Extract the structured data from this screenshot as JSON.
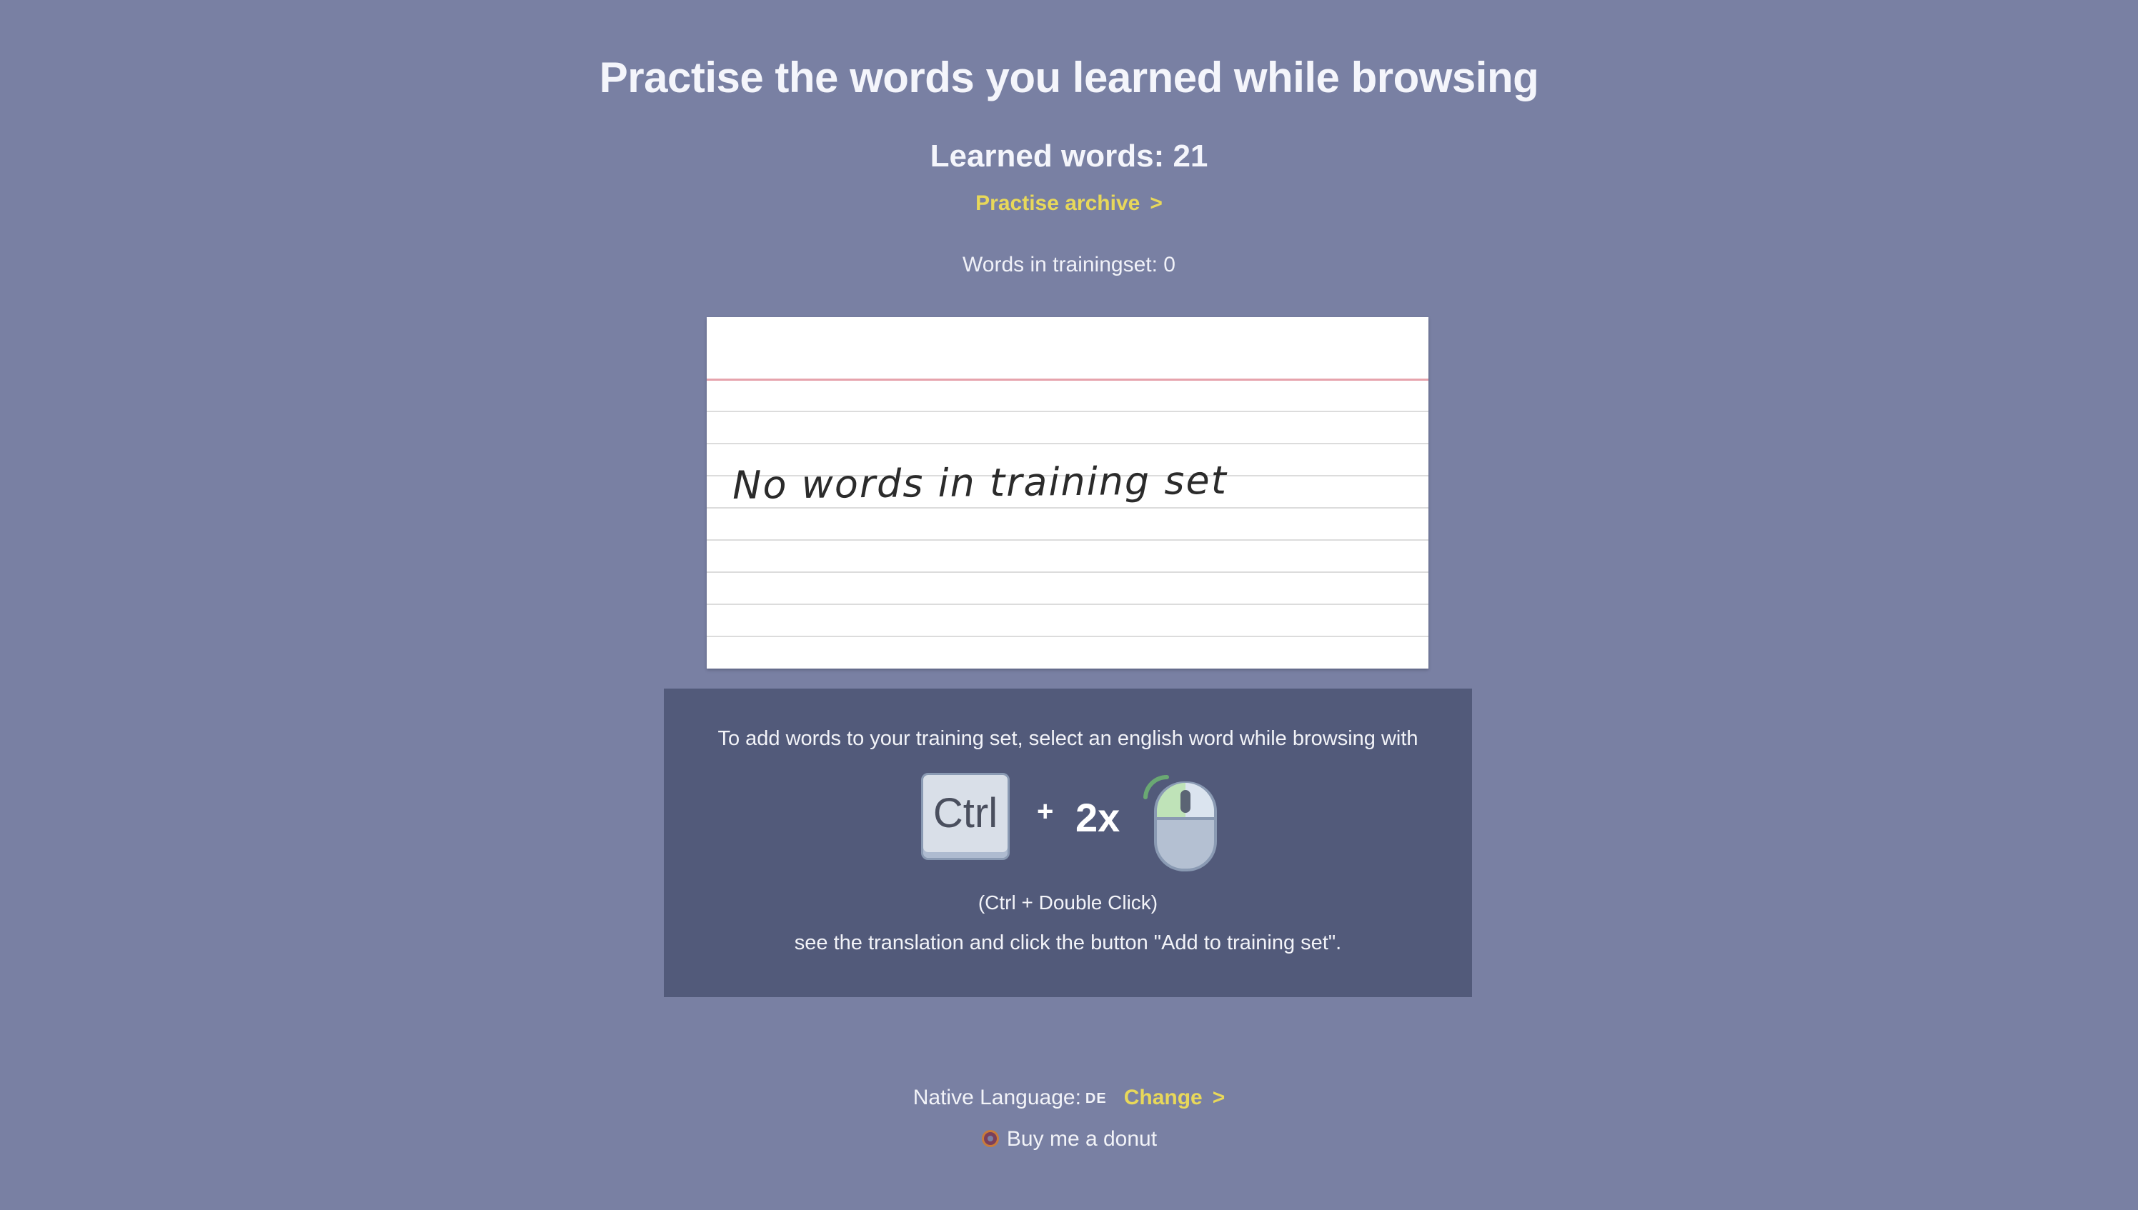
{
  "header": {
    "title": "Practise the words you learned while browsing",
    "learned_words": "Learned words: 21",
    "archive_link": "Practise archive",
    "archive_arrow": ">",
    "trainingset_count": "Words in trainingset: 0"
  },
  "card": {
    "message": "No words in training set"
  },
  "instructions": {
    "intro": "To add words to your training set, select an english word while browsing with",
    "key_label": "Ctrl",
    "plus": "+",
    "times": "2x",
    "shortcut": "(Ctrl + Double Click)",
    "outro": "see the translation and click the button \"Add to training set\"."
  },
  "footer": {
    "native_language_label": "Native Language:",
    "native_language_code": "DE",
    "change_link": "Change",
    "change_arrow": ">",
    "donut_link": "Buy me a donut"
  },
  "colors": {
    "background": "#7980a3",
    "panel": "#525a7a",
    "accent_link": "#e8d85a",
    "card_margin_line": "#e6a3ac"
  },
  "icons": {
    "keyboard_key": "ctrl-key-icon",
    "mouse": "mouse-double-click-icon",
    "donut": "donut-icon"
  }
}
